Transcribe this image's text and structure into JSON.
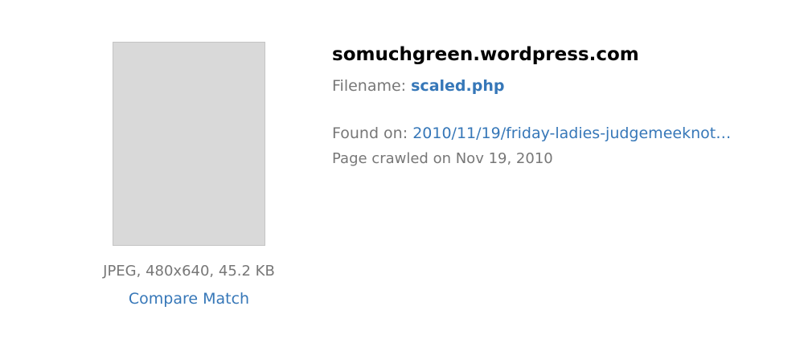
{
  "colors": {
    "link": "#3677b8",
    "muted": "#777777",
    "heading": "#000000"
  },
  "result": {
    "site": "somuchgreen.wordpress.com",
    "filename_label": "Filename:",
    "filename": "scaled.php",
    "found_on_label": "Found on:",
    "found_on_link": "2010/11/19/friday-ladies-judgemeeknot…",
    "crawled": "Page crawled on Nov 19, 2010",
    "file_info": "JPEG, 480x640, 45.2 KB",
    "compare_label": "Compare Match"
  }
}
